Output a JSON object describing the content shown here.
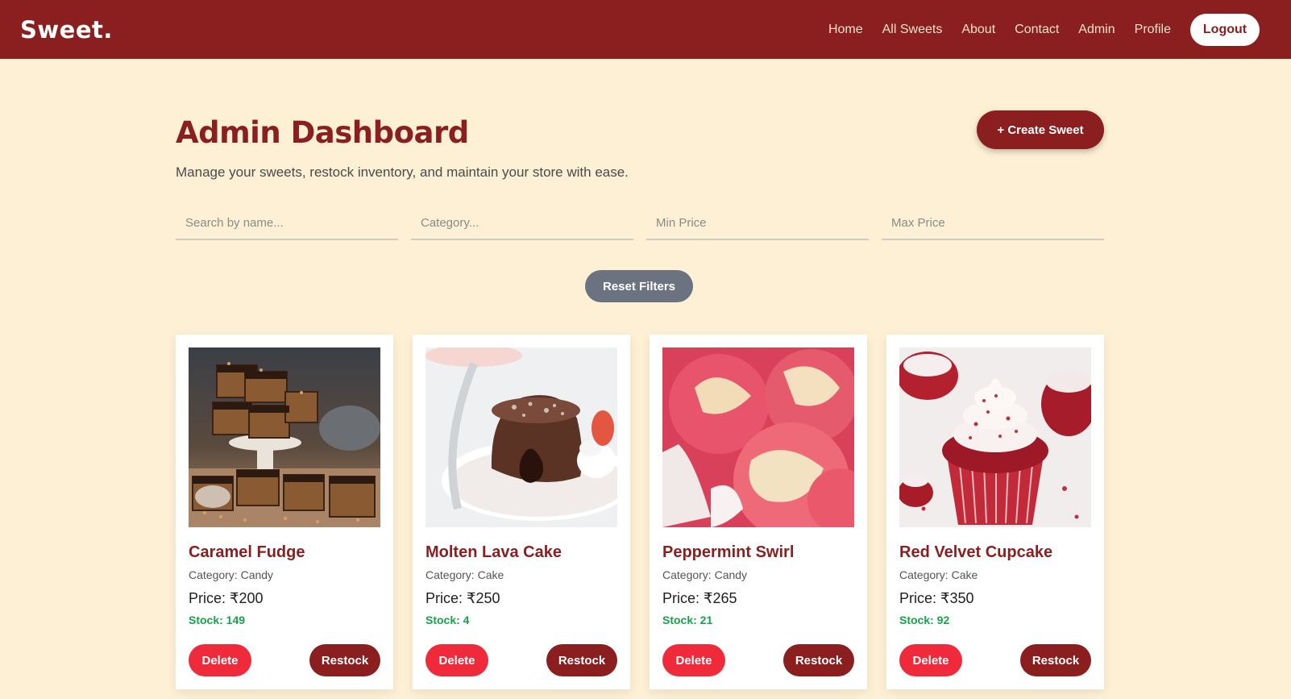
{
  "header": {
    "brand": "Sweet.",
    "nav": [
      "Home",
      "All Sweets",
      "About",
      "Contact",
      "Admin",
      "Profile"
    ],
    "logout_label": "Logout"
  },
  "main": {
    "title": "Admin Dashboard",
    "subtitle": "Manage your sweets, restock inventory, and maintain your store with ease.",
    "create_label": "+ Create Sweet",
    "filters": {
      "search_placeholder": "Search by name...",
      "category_placeholder": "Category...",
      "min_placeholder": "Min Price",
      "max_placeholder": "Max Price",
      "reset_label": "Reset Filters"
    },
    "delete_label": "Delete",
    "restock_label": "Restock",
    "cards": [
      {
        "name": "Caramel Fudge",
        "category": "Category: Candy",
        "price": "Price: ₹200",
        "stock": "Stock: 149",
        "image": "caramel-fudge-photo"
      },
      {
        "name": "Molten Lava Cake",
        "category": "Category: Cake",
        "price": "Price: ₹250",
        "stock": "Stock: 4",
        "image": "molten-lava-cake-photo"
      },
      {
        "name": "Peppermint Swirl",
        "category": "Category: Candy",
        "price": "Price: ₹265",
        "stock": "Stock: 21",
        "image": "peppermint-swirl-photo"
      },
      {
        "name": "Red Velvet Cupcake",
        "category": "Category: Cake",
        "price": "Price: ₹350",
        "stock": "Stock: 92",
        "image": "red-velvet-cupcake-photo"
      }
    ]
  },
  "colors": {
    "brand": "#8b1e1f",
    "background": "#fdf0d5",
    "delete": "#ef2b3b",
    "reset": "#6b7280",
    "stock": "#16a34a"
  }
}
